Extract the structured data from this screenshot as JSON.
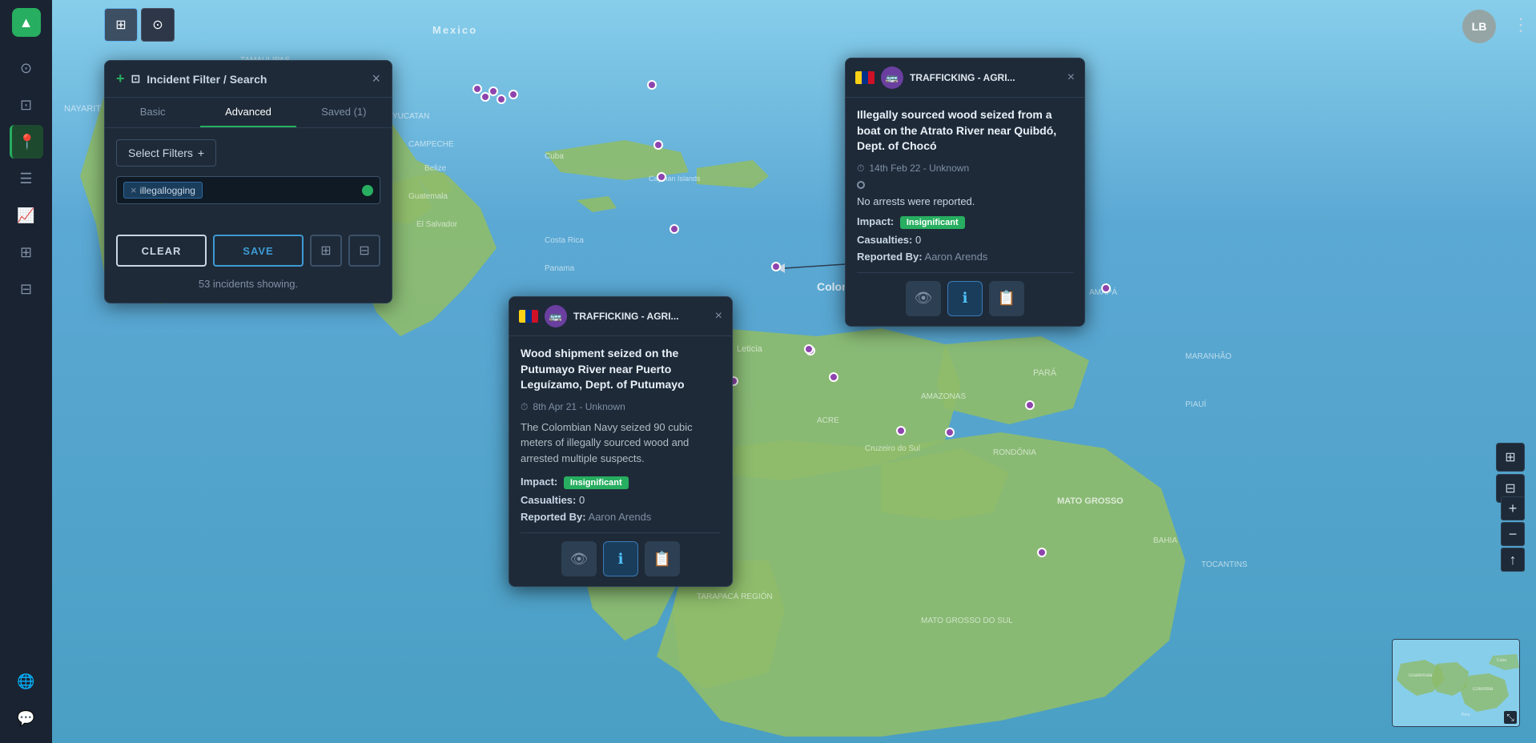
{
  "app": {
    "logo_text": "▲",
    "user_initials": "LB"
  },
  "toolbar": {
    "map_btn_label": "⊞",
    "search_btn_label": "⊙"
  },
  "sidebar": {
    "items": [
      {
        "id": "map",
        "icon": "⊙",
        "label": "Map View",
        "active": false
      },
      {
        "id": "filter",
        "icon": "⊡",
        "label": "Filters",
        "active": false
      },
      {
        "id": "pin",
        "icon": "📍",
        "label": "Locations",
        "active": true
      },
      {
        "id": "layers",
        "icon": "☰",
        "label": "Layers",
        "active": false
      },
      {
        "id": "chart",
        "icon": "📈",
        "label": "Analytics",
        "active": false
      },
      {
        "id": "grid",
        "icon": "⊞",
        "label": "Grid View",
        "active": false
      },
      {
        "id": "table",
        "icon": "⊟",
        "label": "Table View",
        "active": false
      },
      {
        "id": "globe",
        "icon": "🌐",
        "label": "Globe View",
        "active": false
      },
      {
        "id": "chat",
        "icon": "💬",
        "label": "Messages",
        "active": false
      }
    ]
  },
  "filter_panel": {
    "title": "Incident Filter / Search",
    "tabs": [
      {
        "id": "basic",
        "label": "Basic",
        "active": false
      },
      {
        "id": "advanced",
        "label": "Advanced",
        "active": true
      },
      {
        "id": "saved",
        "label": "Saved (1)",
        "active": false
      }
    ],
    "select_filters_label": "Select Filters",
    "add_icon": "+",
    "active_tag": "illegallogging",
    "tag_remove_icon": "×",
    "clear_btn": "CLEAR",
    "save_btn": "SAVE",
    "export_icon": "⊞",
    "download_icon": "⊟",
    "incidents_count": "53 incidents showing."
  },
  "popup_putumayo": {
    "country_code": "CO",
    "type_icon": "🚐",
    "header_title": "TRAFFICKING - AGRI...",
    "main_title": "Wood shipment seized on the Putumayo River near Puerto Leguízamo, Dept. of Putumayo",
    "date": "8th Apr 21 - Unknown",
    "description": "The Colombian Navy seized 90 cubic meters of illegally sourced wood and arrested multiple suspects.",
    "impact_label": "Impact:",
    "impact_value": "Insignificant",
    "casualties_label": "Casualties:",
    "casualties_value": "0",
    "reported_label": "Reported By:",
    "reported_value": "Aaron Arends"
  },
  "popup_atrato": {
    "country_code": "CO",
    "type_icon": "🚐",
    "header_title": "TRAFFICKING - AGRI...",
    "main_title": "Illegally sourced wood seized from a boat on the Atrato River near Quibdó, Dept. of Chocó",
    "date": "14th Feb 22 - Unknown",
    "no_arrests": "No arrests were reported.",
    "impact_label": "Impact:",
    "impact_value": "Insignificant",
    "casualties_label": "Casualties:",
    "casualties_value": "0",
    "reported_label": "Reported By:",
    "reported_value": "Aaron Arends"
  },
  "map_controls": {
    "zoom_in": "+",
    "zoom_out": "−",
    "reset": "↑",
    "layers_icon": "⊞",
    "map_type_icon": "⊟"
  }
}
